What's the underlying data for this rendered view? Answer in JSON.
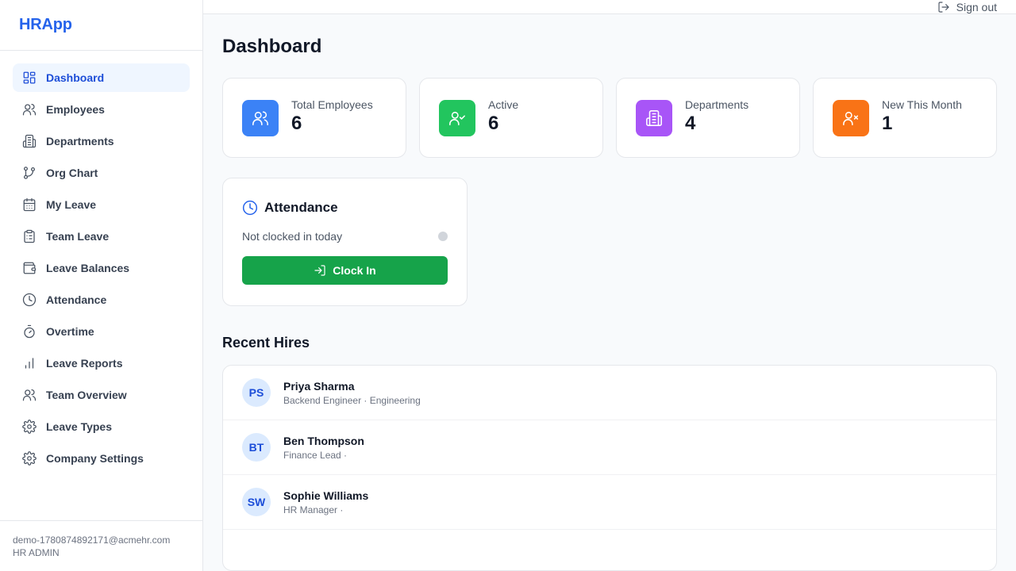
{
  "brand": "HRApp",
  "sidebar": {
    "items": [
      {
        "label": "Dashboard",
        "icon": "dashboard-icon",
        "active": true
      },
      {
        "label": "Employees",
        "icon": "users-icon"
      },
      {
        "label": "Departments",
        "icon": "building-icon"
      },
      {
        "label": "Org Chart",
        "icon": "git-branch-icon"
      },
      {
        "label": "My Leave",
        "icon": "calendar-icon"
      },
      {
        "label": "Team Leave",
        "icon": "clipboard-icon"
      },
      {
        "label": "Leave Balances",
        "icon": "wallet-icon"
      },
      {
        "label": "Attendance",
        "icon": "clock-icon"
      },
      {
        "label": "Overtime",
        "icon": "timer-icon"
      },
      {
        "label": "Leave Reports",
        "icon": "bar-chart-icon"
      },
      {
        "label": "Team Overview",
        "icon": "users-icon"
      },
      {
        "label": "Leave Types",
        "icon": "gear-icon"
      },
      {
        "label": "Company Settings",
        "icon": "gear-icon"
      }
    ]
  },
  "user": {
    "email": "demo-1780874892171@acmehr.com",
    "role": "HR ADMIN"
  },
  "topbar": {
    "signout_label": "Sign out"
  },
  "page": {
    "title": "Dashboard"
  },
  "stats": [
    {
      "label": "Total Employees",
      "value": "6",
      "icon": "users-icon",
      "color": "#3b82f6"
    },
    {
      "label": "Active",
      "value": "6",
      "icon": "user-check-icon",
      "color": "#22c55e"
    },
    {
      "label": "Departments",
      "value": "4",
      "icon": "building-icon",
      "color": "#a855f7"
    },
    {
      "label": "New This Month",
      "value": "1",
      "icon": "user-x-icon",
      "color": "#f97316"
    }
  ],
  "attendance": {
    "title": "Attendance",
    "status": "Not clocked in today",
    "button_label": "Clock In"
  },
  "recent_hires": {
    "title": "Recent Hires",
    "rows": [
      {
        "initials": "PS",
        "name": "Priya Sharma",
        "subtitle": "Backend Engineer · Engineering"
      },
      {
        "initials": "BT",
        "name": "Ben Thompson",
        "subtitle": "Finance Lead ·"
      },
      {
        "initials": "SW",
        "name": "Sophie Williams",
        "subtitle": "HR Manager ·"
      }
    ]
  },
  "colors": {
    "accent": "#2563eb",
    "active_bg": "#eff6ff",
    "clock_in": "#16a34a",
    "avatar_bg": "#dbeafe"
  }
}
